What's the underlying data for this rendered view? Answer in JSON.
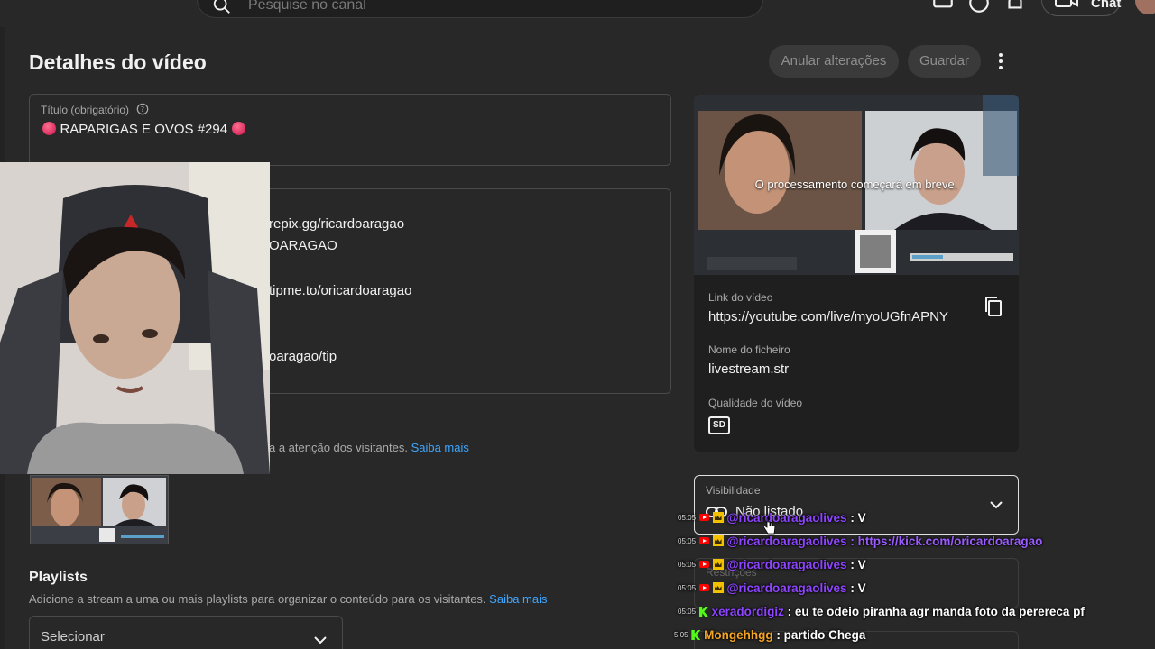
{
  "header": {
    "search_placeholder": "Pesquise no canal",
    "chat_label": "Chat"
  },
  "page": {
    "title": "Detalhes do vídeo",
    "undo_label": "Anular alterações",
    "save_label": "Guardar"
  },
  "title_field": {
    "label": "Título (obrigatório)",
    "value": "RAPARIGAS E OVOS #294"
  },
  "description_lines": [
    "repix.gg/ricardoaragao",
    "OARAGAO",
    "tipme.to/oricardoaragao",
    "oaragao/tip"
  ],
  "thumbnail_hint": {
    "text": "a a atenção dos visitantes.",
    "link": "Saiba mais"
  },
  "playlists": {
    "heading": "Playlists",
    "subtitle": "Adicione a stream a uma ou mais playlists para organizar o conteúdo para os visitantes.",
    "link": "Saiba mais",
    "select_label": "Selecionar"
  },
  "video_card": {
    "processing_text": "O processamento começará em breve.",
    "link_label": "Link do vídeo",
    "link_value": "https://youtube.com/live/myoUGfnAPNY",
    "filename_label": "Nome do ficheiro",
    "filename_value": "livestream.str",
    "quality_label": "Qualidade do vídeo",
    "quality_badge": "SD"
  },
  "visibility": {
    "label": "Visibilidade",
    "value": "Não listado"
  },
  "restrictions": {
    "label": "Restrições"
  },
  "chat_overlay": [
    {
      "time": "05:05",
      "platform": "youtube",
      "user": "@ricardoaragaolives",
      "msg": ": V"
    },
    {
      "time": "05:05",
      "platform": "youtube",
      "user": "@ricardoaragaolives",
      "msg": ": https://kick.com/oricardoaragao"
    },
    {
      "time": "05:05",
      "platform": "youtube",
      "user": "@ricardoaragaolives",
      "msg": ": V"
    },
    {
      "time": "05:05",
      "platform": "youtube",
      "user": "@ricardoaragaolives",
      "msg": ": V"
    },
    {
      "time": "05:05",
      "platform": "kick",
      "user": "xeradordigiz",
      "msg": ": eu te odeio piranha agr manda foto da perereca pf"
    },
    {
      "time": "5:05",
      "platform": "kick",
      "user": "Mongehhgg",
      "msg": ": partido Chega"
    }
  ],
  "colors": {
    "background": "#282828",
    "link": "#3ea6ff",
    "chat_user_youtube": "#8e45ff",
    "chat_user_kick_orange": "#f5a524",
    "kick_green": "#53fc18"
  },
  "icons": [
    "search-icon",
    "comment-icon",
    "help-icon",
    "bell-icon",
    "create-video-icon",
    "more-vert-icon",
    "help-circle-icon",
    "copy-icon",
    "sd-icon",
    "link-icon",
    "chevron-down-icon"
  ]
}
